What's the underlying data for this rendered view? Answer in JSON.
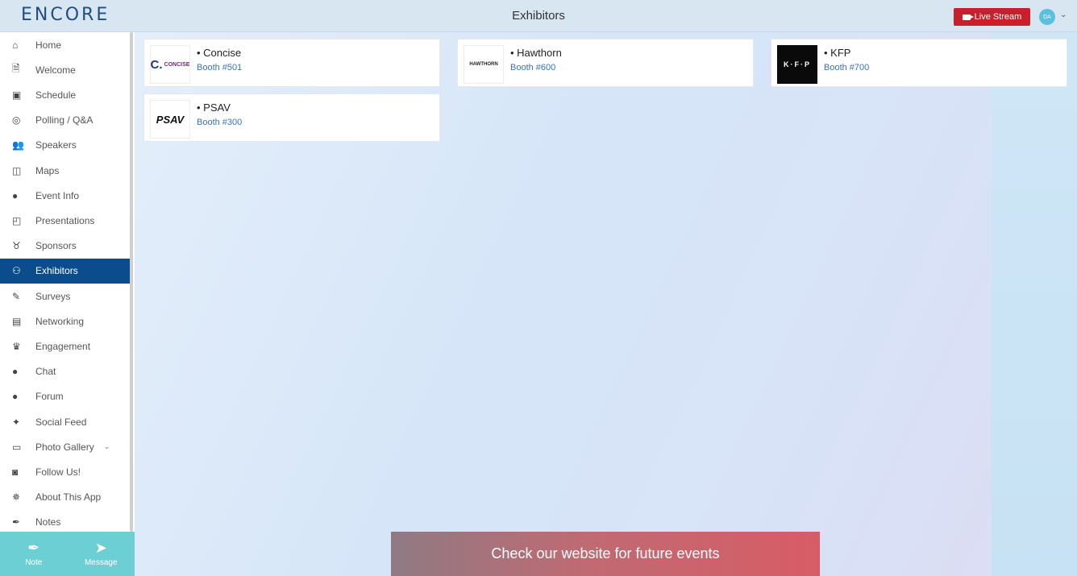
{
  "header": {
    "logo": "ENCORE",
    "title": "Exhibitors",
    "live_stream_label": "Live Stream",
    "avatar_initials": "DA"
  },
  "sidebar": {
    "items": [
      {
        "label": "Home",
        "icon": "home-icon",
        "glyph": "⌂"
      },
      {
        "label": "Welcome",
        "icon": "document-icon",
        "glyph": "🗎"
      },
      {
        "label": "Schedule",
        "icon": "calendar-icon",
        "glyph": "▣"
      },
      {
        "label": "Polling / Q&A",
        "icon": "chat-poll-icon",
        "glyph": "◎"
      },
      {
        "label": "Speakers",
        "icon": "users-icon",
        "glyph": "👥"
      },
      {
        "label": "Maps",
        "icon": "map-icon",
        "glyph": "◫"
      },
      {
        "label": "Event Info",
        "icon": "info-icon",
        "glyph": "●"
      },
      {
        "label": "Presentations",
        "icon": "file-icon",
        "glyph": "◰"
      },
      {
        "label": "Sponsors",
        "icon": "medal-icon",
        "glyph": "♉"
      },
      {
        "label": "Exhibitors",
        "icon": "binoculars-icon",
        "glyph": "⚇"
      },
      {
        "label": "Surveys",
        "icon": "survey-icon",
        "glyph": "✎"
      },
      {
        "label": "Networking",
        "icon": "id-card-icon",
        "glyph": "▤"
      },
      {
        "label": "Engagement",
        "icon": "crown-icon",
        "glyph": "♛"
      },
      {
        "label": "Chat",
        "icon": "chat-icon",
        "glyph": "●"
      },
      {
        "label": "Forum",
        "icon": "forum-icon",
        "glyph": "●"
      },
      {
        "label": "Social Feed",
        "icon": "twitter-icon",
        "glyph": "✦"
      },
      {
        "label": "Photo Gallery",
        "icon": "monitor-icon",
        "glyph": "▭"
      },
      {
        "label": "Follow Us!",
        "icon": "camera-icon",
        "glyph": "◙"
      },
      {
        "label": "About This App",
        "icon": "gear-icon",
        "glyph": "✵"
      },
      {
        "label": "Notes",
        "icon": "pen-icon",
        "glyph": "✒"
      }
    ],
    "bottom": {
      "note_label": "Note",
      "message_label": "Message"
    }
  },
  "exhibitors": [
    {
      "name": "• Concise",
      "booth": "Booth #501",
      "logo_text": "CONCISE"
    },
    {
      "name": "• Hawthorn",
      "booth": "Booth #600",
      "logo_text": "HAWTHORN"
    },
    {
      "name": "• KFP",
      "booth": "Booth #700",
      "logo_text": "K·F·P"
    },
    {
      "name": "• PSAV",
      "booth": "Booth #300",
      "logo_text": "PSAV"
    }
  ],
  "banner_text": "Check our website for future events"
}
